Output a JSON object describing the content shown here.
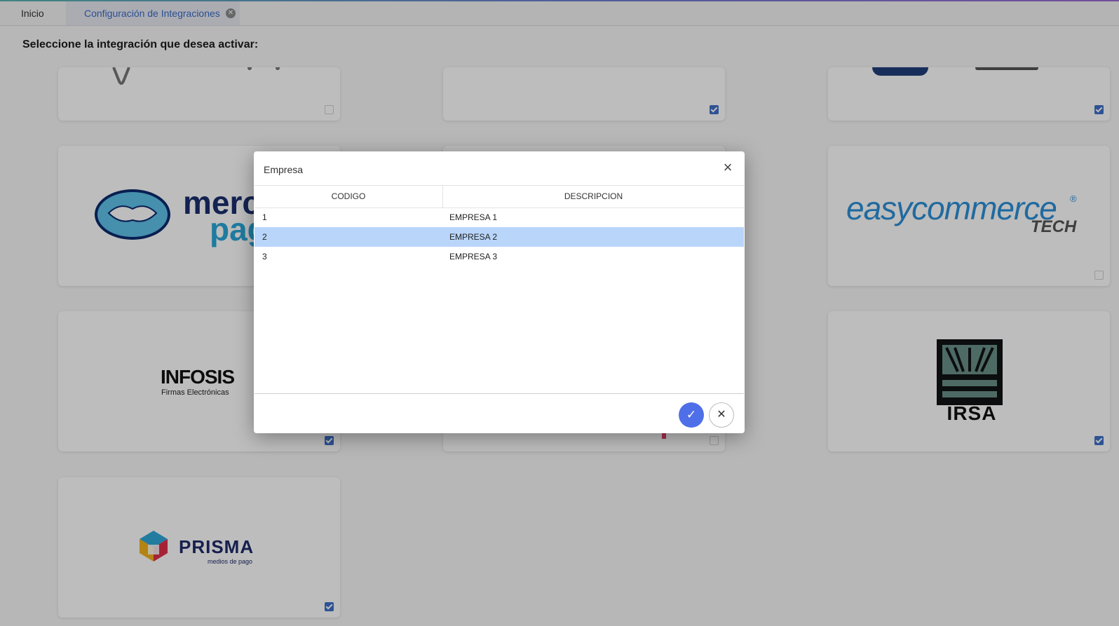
{
  "tabs": [
    {
      "label": "Inicio"
    },
    {
      "label": "Configuración de Integraciones"
    }
  ],
  "heading": "Seleccione la integración que desea activar:",
  "cards": {
    "mercadopago": {
      "text1": "merc",
      "text2": "pag",
      "checked": false
    },
    "easycommerce": {
      "text1": "easycommerce",
      "text2": "TECH",
      "reg": "®",
      "checked": false
    },
    "infosis": {
      "name": "INFOSIS",
      "sub": "Firmas Electrónicas",
      "checked": true
    },
    "irsa": {
      "name": "IRSA",
      "checked": true
    },
    "prisma": {
      "name": "PRISMA",
      "sub": "medios de pago",
      "checked": true
    }
  },
  "modal": {
    "title": "Empresa",
    "columns": {
      "code": "CODIGO",
      "description": "DESCRIPCION"
    },
    "rows": [
      {
        "code": "1",
        "description": "EMPRESA 1"
      },
      {
        "code": "2",
        "description": "EMPRESA 2"
      },
      {
        "code": "3",
        "description": "EMPRESA 3"
      }
    ],
    "selected_row": 2
  },
  "icons": {
    "ok": "check-icon",
    "cancel": "close-icon",
    "tab_close": "tab-close-icon"
  },
  "colors": {
    "accent": "#4f6fe8",
    "tab_active": "#3b6bc6",
    "selected_row": "#b9d5fa",
    "checkbox": "#3f70c8"
  }
}
